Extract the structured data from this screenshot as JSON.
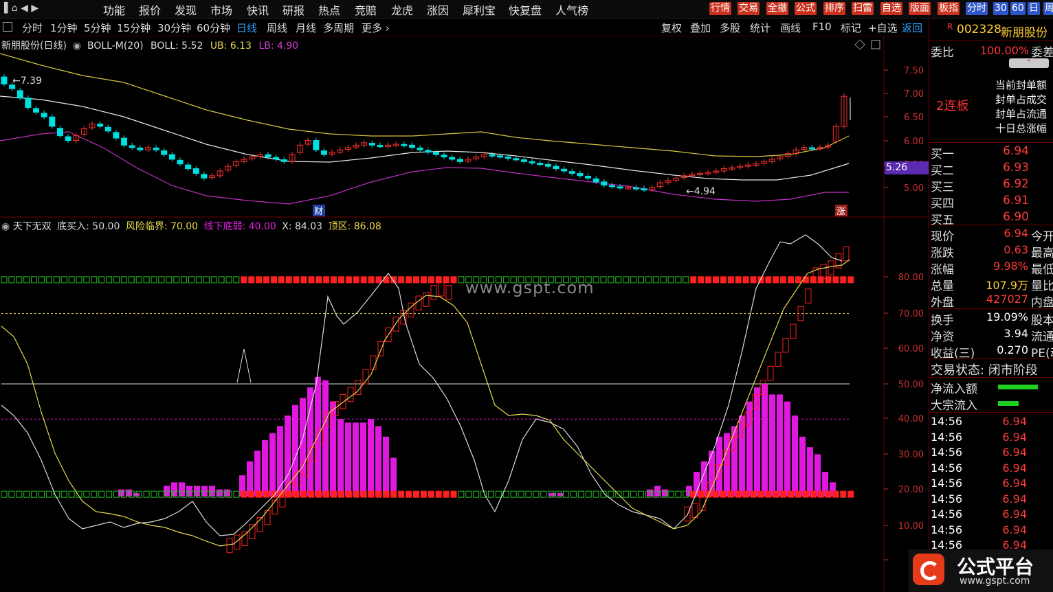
{
  "top_menu": [
    "功能",
    "报价",
    "发现",
    "市场",
    "快讯",
    "研报",
    "热点",
    "竞赔",
    "龙虎",
    "涨因",
    "犀利宝",
    "快复盘",
    "人气榜"
  ],
  "top_buttons": [
    {
      "label": "行情",
      "style": "red"
    },
    {
      "label": "交易",
      "style": "red"
    },
    {
      "label": "全撤",
      "style": "red"
    },
    {
      "label": "公式",
      "style": "red"
    },
    {
      "label": "排序",
      "style": "red"
    },
    {
      "label": "扫雷",
      "style": "red"
    },
    {
      "label": "自选",
      "style": "red"
    },
    {
      "label": "版面",
      "style": "red"
    },
    {
      "label": "板指",
      "style": "red"
    },
    {
      "label": "分时",
      "style": "blue"
    },
    {
      "label": "30",
      "style": "blue"
    },
    {
      "label": "60",
      "style": "blue"
    },
    {
      "label": "日",
      "style": "blue"
    },
    {
      "label": "周",
      "style": "blue"
    }
  ],
  "periods": [
    "分时",
    "1分钟",
    "5分钟",
    "15分钟",
    "30分钟",
    "60分钟",
    "日线",
    "周线",
    "月线",
    "多周期",
    "更多"
  ],
  "active_period": "日线",
  "right_tools": [
    "复权",
    "叠加",
    "多股",
    "统计",
    "画线",
    "F10",
    "标记",
    "+自选",
    "返回"
  ],
  "main_legend": {
    "title": "新朋股份(日线)",
    "indicator": "BOLL-M(20)",
    "boll": "BOLL: 5.52",
    "ub": "UB: 6.13",
    "lb": "LB: 4.90"
  },
  "main_axis": [
    "7.50",
    "7.00",
    "6.50",
    "6.00",
    "5.50",
    "5.00"
  ],
  "current_price_tag": "5.26",
  "high_label": "7.39",
  "low_label": "4.94",
  "markers": {
    "cai": "财",
    "zhang": "涨"
  },
  "sub_legend": {
    "name": "天下无双",
    "buy": "底买入: 50.00",
    "risk": "风险临界: 70.00",
    "weak": "线下底弱: 40.00",
    "x": "X: 84.03",
    "top": "顶区: 86.08"
  },
  "sub_axis": [
    "80.00",
    "70.00",
    "60.00",
    "50.00",
    "40.00",
    "30.00",
    "20.00",
    "10.00",
    "0"
  ],
  "watermark": "www.gspt.com",
  "right_panel": {
    "code": "002328",
    "name": "新朋股份",
    "weibi_label": "委比",
    "weibi": "100.00%",
    "weicha": "委差",
    "lianban": "2连板",
    "seal_info": [
      "当前封单额",
      "封单占成交",
      "封单占流通",
      "十日总涨幅"
    ],
    "bids": [
      {
        "label": "买一",
        "price": "6.94"
      },
      {
        "label": "买二",
        "price": "6.93"
      },
      {
        "label": "买三",
        "price": "6.92"
      },
      {
        "label": "买四",
        "price": "6.91"
      },
      {
        "label": "买五",
        "price": "6.90"
      }
    ],
    "stats": [
      {
        "label": "现价",
        "value": "6.94",
        "side": "今开"
      },
      {
        "label": "涨跌",
        "value": "0.63",
        "side": "最高"
      },
      {
        "label": "涨幅",
        "value": "9.98%",
        "side": "最低"
      },
      {
        "label": "总量",
        "value": "107.9万",
        "side": "量比"
      },
      {
        "label": "外盘",
        "value": "427027",
        "side": "内盘"
      }
    ],
    "stats2": [
      {
        "label": "换手",
        "value": "19.09%",
        "side": "股本"
      },
      {
        "label": "净资",
        "value": "3.94",
        "side": "流通"
      },
      {
        "label": "收益(三)",
        "value": "0.270",
        "side": "PE(动)"
      }
    ],
    "status": "交易状态: 闭市阶段",
    "flows": [
      {
        "label": "净流入额"
      },
      {
        "label": "大宗流入"
      }
    ],
    "ticks": [
      {
        "time": "14:56",
        "price": "6.94"
      },
      {
        "time": "14:56",
        "price": "6.94"
      },
      {
        "time": "14:56",
        "price": "6.94"
      },
      {
        "time": "14:56",
        "price": "6.94"
      },
      {
        "time": "14:56",
        "price": "6.94"
      },
      {
        "time": "14:56",
        "price": "6.94"
      },
      {
        "time": "14:56",
        "price": "6.94"
      },
      {
        "time": "14:56",
        "price": "6.94"
      },
      {
        "time": "14:56",
        "price": "6.94"
      }
    ]
  },
  "logo": {
    "text": "公式平台",
    "url": "www.gspt.com"
  },
  "colors": {
    "up": "#ff3030",
    "down": "#00e0e0",
    "boll_mid": "#e8e8e8",
    "boll_ub": "#d8c840",
    "boll_lb": "#c030c0",
    "magenta": "#e018e0",
    "green": "#20c020",
    "yellow": "#e8d850"
  }
}
